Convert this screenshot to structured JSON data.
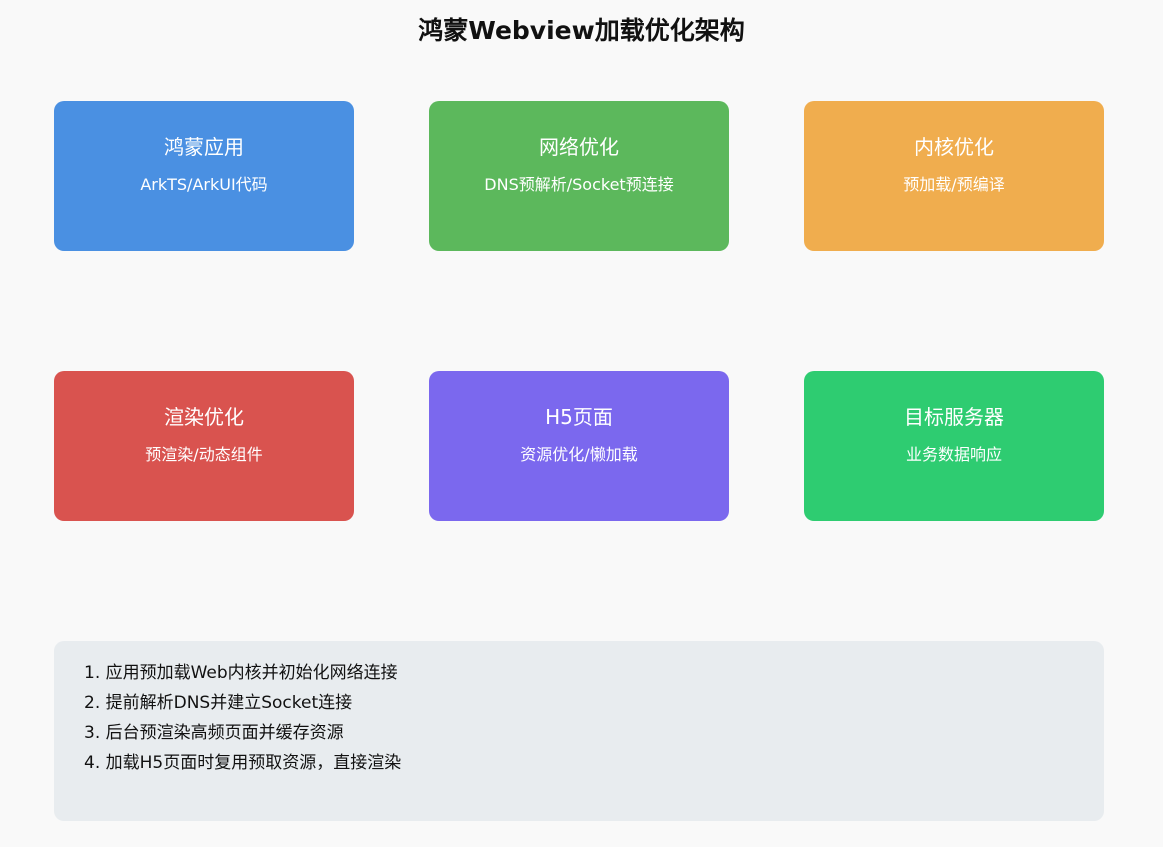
{
  "title": "鸿蒙Webview加载优化架构",
  "colors": {
    "app": "#4a90e2",
    "network": "#5cb85c",
    "kernel": "#f0ad4e",
    "render": "#d9534f",
    "h5": "#7b68ee",
    "server": "#2ecc71",
    "steps_bg": "#e8ecef"
  },
  "boxes": [
    {
      "title": "鸿蒙应用",
      "subtitle": "ArkTS/ArkUI代码",
      "color": "#4a90e2"
    },
    {
      "title": "网络优化",
      "subtitle": "DNS预解析/Socket预连接",
      "color": "#5cb85c"
    },
    {
      "title": "内核优化",
      "subtitle": "预加载/预编译",
      "color": "#f0ad4e"
    },
    {
      "title": "渲染优化",
      "subtitle": "预渲染/动态组件",
      "color": "#d9534f"
    },
    {
      "title": "H5页面",
      "subtitle": "资源优化/懒加载",
      "color": "#7b68ee"
    },
    {
      "title": "目标服务器",
      "subtitle": "业务数据响应",
      "color": "#2ecc71"
    }
  ],
  "steps": [
    "1. 应用预加载Web内核并初始化网络连接",
    "2. 提前解析DNS并建立Socket连接",
    "3. 后台预渲染高频页面并缓存资源",
    "4. 加载H5页面时复用预取资源，直接渲染"
  ]
}
